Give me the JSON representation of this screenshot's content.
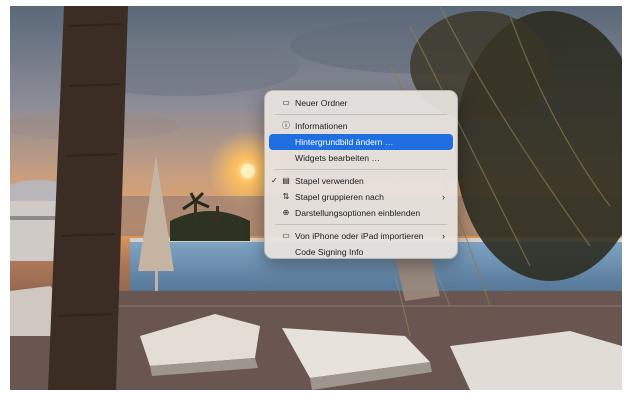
{
  "menu": {
    "items": [
      {
        "label": "Neuer Ordner",
        "icon": "new-folder-icon"
      },
      {
        "label": "Informationen",
        "icon": "info-icon"
      },
      {
        "label": "Hintergrundbild ändern …",
        "icon": "",
        "highlighted": true
      },
      {
        "label": "Widgets bearbeiten …",
        "icon": ""
      },
      {
        "label": "Stapel verwenden",
        "icon": "stack-icon",
        "checked": true
      },
      {
        "label": "Stapel gruppieren nach",
        "icon": "sort-icon",
        "submenu": true
      },
      {
        "label": "Darstellungsoptionen einblenden",
        "icon": "view-options-icon"
      },
      {
        "label": "Von iPhone oder iPad importieren",
        "icon": "device-import-icon",
        "submenu": true
      },
      {
        "label": "Code Signing Info",
        "icon": ""
      }
    ],
    "checkmark": "✓",
    "chevron": "›"
  },
  "colors": {
    "highlight": "#1f6fe0",
    "menu_bg": "#e8e4e0"
  }
}
